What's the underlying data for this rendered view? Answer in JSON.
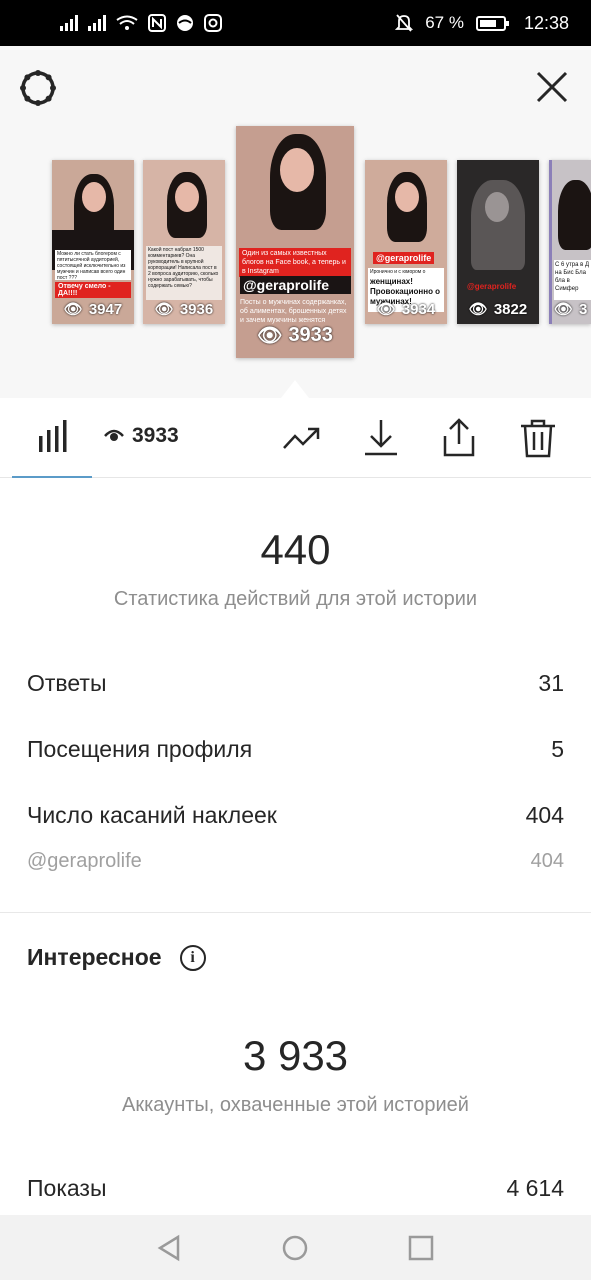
{
  "status_bar": {
    "battery": "67 %",
    "time": "12:38",
    "icons": [
      "signal-icon",
      "signal-icon",
      "wifi-icon",
      "nfc-icon",
      "vpn-icon",
      "instagram-icon",
      "mute-icon",
      "battery-icon"
    ]
  },
  "stories": [
    {
      "views": "3947",
      "caption": "Можно ли стать блогером с пятитысячной аудиторией, состоящей исключительно из мужчин и написав всего один пост ???",
      "banner": "Отвечу смело - ДА!!!!"
    },
    {
      "views": "3936",
      "caption": "Какой пост набрал 1500 комментариев? Она руководитель в крупной корпорации! Написала пост в 2 вопроса аудиторию, сколько нужно зарабатывать, чтобы содержать семью?"
    },
    {
      "views": "3933",
      "caption": "Один из самых известных блогов на Face book, а теперь и в Instagram",
      "handle": "@geraprolife",
      "body": "Посты о мужчинах содержанках, об алиментах, брошенных детях и зачем мужчины женятся"
    },
    {
      "views": "3934",
      "caption": "Иронично и с юмором о",
      "handle": "@geraprolife",
      "big": "женщинах! Провокационно о мужчинах!"
    },
    {
      "views": "3822",
      "handle": "@geraprolife"
    },
    {
      "views": "3",
      "caption": "С 6 утра в Д на Бис Бла бла в Симфер"
    }
  ],
  "toolbar": {
    "views": "3933",
    "icons": [
      "bar-chart-icon",
      "eye-icon",
      "trending-icon",
      "download-icon",
      "share-icon",
      "trash-icon"
    ]
  },
  "actions": {
    "total": "440",
    "label": "Статистика действий для этой истории",
    "rows": [
      {
        "label": "Ответы",
        "value": "31"
      },
      {
        "label": "Посещения профиля",
        "value": "5"
      },
      {
        "label": "Число касаний наклеек",
        "value": "404"
      }
    ],
    "sticker": {
      "label": "@geraprolife",
      "value": "404"
    }
  },
  "discovery": {
    "title": "Интересное",
    "reach": "3 933",
    "reach_label": "Аккаунты, охваченные этой историей",
    "impressions_label": "Показы",
    "impressions_value": "4 614"
  },
  "colors": {
    "tab_underline": "#5b9bc8",
    "banner_red": "#e0231f"
  }
}
